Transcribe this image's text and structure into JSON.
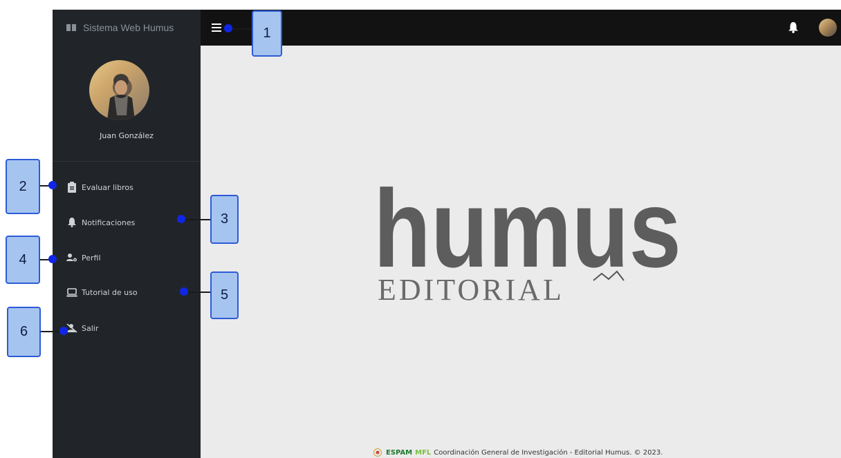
{
  "sidebar": {
    "brand": "Sistema Web Humus",
    "user_name": "Juan González",
    "items": [
      {
        "label": "Evaluar libros",
        "icon": "clipboard-icon"
      },
      {
        "label": "Notificaciones",
        "icon": "bell-icon"
      },
      {
        "label": "Perfil",
        "icon": "user-gear-icon"
      },
      {
        "label": "Tutorial de uso",
        "icon": "laptop-icon"
      },
      {
        "label": "Salir",
        "icon": "user-slash-icon"
      }
    ]
  },
  "main": {
    "logo_word": "humus",
    "logo_sub": "EDITORIAL",
    "footer": {
      "brand_a": "ESPAM",
      "brand_b": "MFL",
      "text": "Coordinación General de Investigación - Editorial Humus. © 2023."
    }
  },
  "annotations": [
    "1",
    "2",
    "3",
    "4",
    "5",
    "6"
  ]
}
